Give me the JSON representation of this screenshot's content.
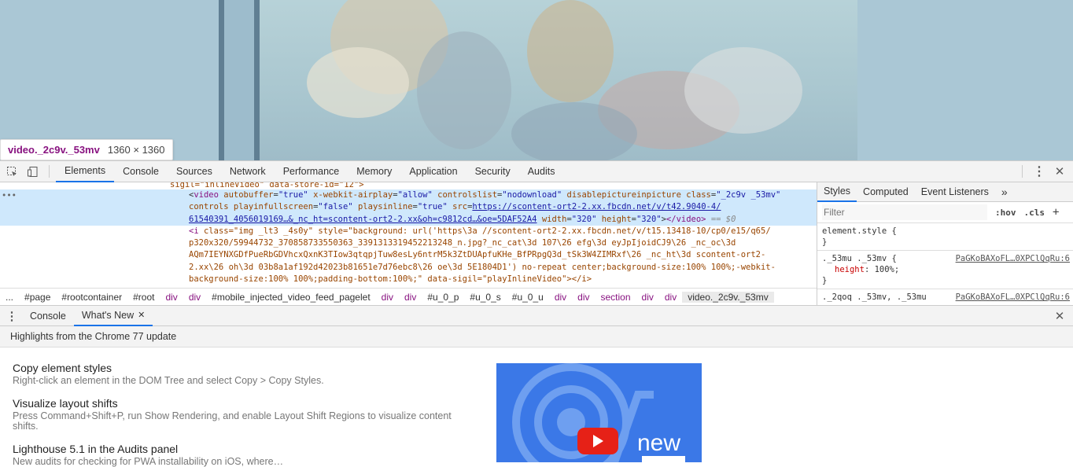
{
  "tooltip": {
    "selector": "video._2c9v._53mv",
    "dimensions": "1360 × 1360"
  },
  "toolbar": {
    "tabs": [
      "Elements",
      "Console",
      "Sources",
      "Network",
      "Performance",
      "Memory",
      "Application",
      "Security",
      "Audits"
    ],
    "active_tab": "Elements"
  },
  "elements": {
    "line0": "sigil=\"inlineVideo\" data-store-id=\"12\">",
    "video_tag": "video",
    "a1": "autobuffer",
    "v1": "\"true\"",
    "a2": "x-webkit-airplay",
    "v2": "\"allow\"",
    "a3": "controlslist",
    "v3": "\"nodownload\"",
    "a4": "disablepictureinpicture",
    "a5": "class",
    "v5": "\"_2c9v _53mv\"",
    "a6": "controls",
    "a7": "playinfullscreen",
    "v7": "\"false\"",
    "a8": "playsinline",
    "v8": "\"true\"",
    "a9": "src",
    "src_link1": "https://scontent-ort2-2.xx.fbcdn.net/v/t42.9040-4/",
    "src_link2": "61540391_4056019169…&_nc_ht=scontent-ort2-2.xx&oh=c9812cd…&oe=5DAF52A4",
    "a10": "width",
    "v10": "\"320\"",
    "a11": "height",
    "v11": "\"320\"",
    "close_video": "</video>",
    "eq0": "== $0",
    "i_line1": "class=\"img _lt3 _4s0y\" style=\"background: url('https\\3a //scontent-ort2-2.xx.fbcdn.net/v/t15.13418-10/cp0/e15/q65/",
    "i_line2": "p320x320/59944732_370858733550363_3391313319452213248_n.jpg?_nc_cat\\3d 107\\26 efg\\3d eyJpIjoidCJ9\\26 _nc_oc\\3d",
    "i_line3": "AQm7IEYNXGDfPueRbGDVhcxQxnK3TIow3qtqpjTuw8esLy6ntrM5k3ZtDUApfuKHe_BfPRpgQ3d_tSk3W4ZIMRxf\\26 _nc_ht\\3d scontent-ort2-",
    "i_line4": "2.xx\\26 oh\\3d 03b8a1af192d42023b81651e7d76ebc8\\26 oe\\3d 5E1804D1') no-repeat center;background-size:100% 100%;-webkit-",
    "i_line5": "background-size:100% 100%;padding-bottom:100%;\" data-sigil=\"playInlineVideo\"></i>",
    "i_tag": "<i"
  },
  "breadcrumbs": [
    "...",
    "#page",
    "#rootcontainer",
    "#root",
    "div",
    "div",
    "#mobile_injected_video_feed_pagelet",
    "div",
    "div",
    "#u_0_p",
    "#u_0_s",
    "#u_0_u",
    "div",
    "div",
    "section",
    "div",
    "div",
    "video._2c9v._53mv"
  ],
  "styles": {
    "tabs": [
      "Styles",
      "Computed",
      "Event Listeners"
    ],
    "more": "»",
    "filter_placeholder": "Filter",
    "hov": ":hov",
    "cls": ".cls",
    "plus": "+",
    "rule1_selector": "element.style {",
    "rule1_close": "}",
    "rule2_selector": "._53mu ._53mv {",
    "rule2_source": "PaGKoBAXoFL…0XPClQqRu:6",
    "rule2_prop": "height",
    "rule2_val": "100%;",
    "rule2_close": "}",
    "rule3_selector": "._2qoq ._53mv, ._53mu",
    "rule3_source": "PaGKoBAXoFL…0XPClQqRu:6"
  },
  "drawer": {
    "tabs": [
      "Console",
      "What's New"
    ],
    "active_tab": "What's New",
    "heading": "Highlights from the Chrome 77 update",
    "features": [
      {
        "title": "Copy element styles",
        "desc": "Right-click an element in the DOM Tree and select Copy > Copy Styles."
      },
      {
        "title": "Visualize layout shifts",
        "desc": "Press Command+Shift+P, run Show Rendering, and enable Layout Shift Regions to visualize content shifts."
      },
      {
        "title": "Lighthouse 5.1 in the Audits panel",
        "desc": "New audits for checking for PWA installability on iOS, where…"
      }
    ],
    "promo_text": "new"
  },
  "colors": {
    "accent": "#1a73e8",
    "tag": "#881280",
    "attr": "#994500",
    "value": "#1a1aa6",
    "selected_row": "#cfe8fc"
  }
}
